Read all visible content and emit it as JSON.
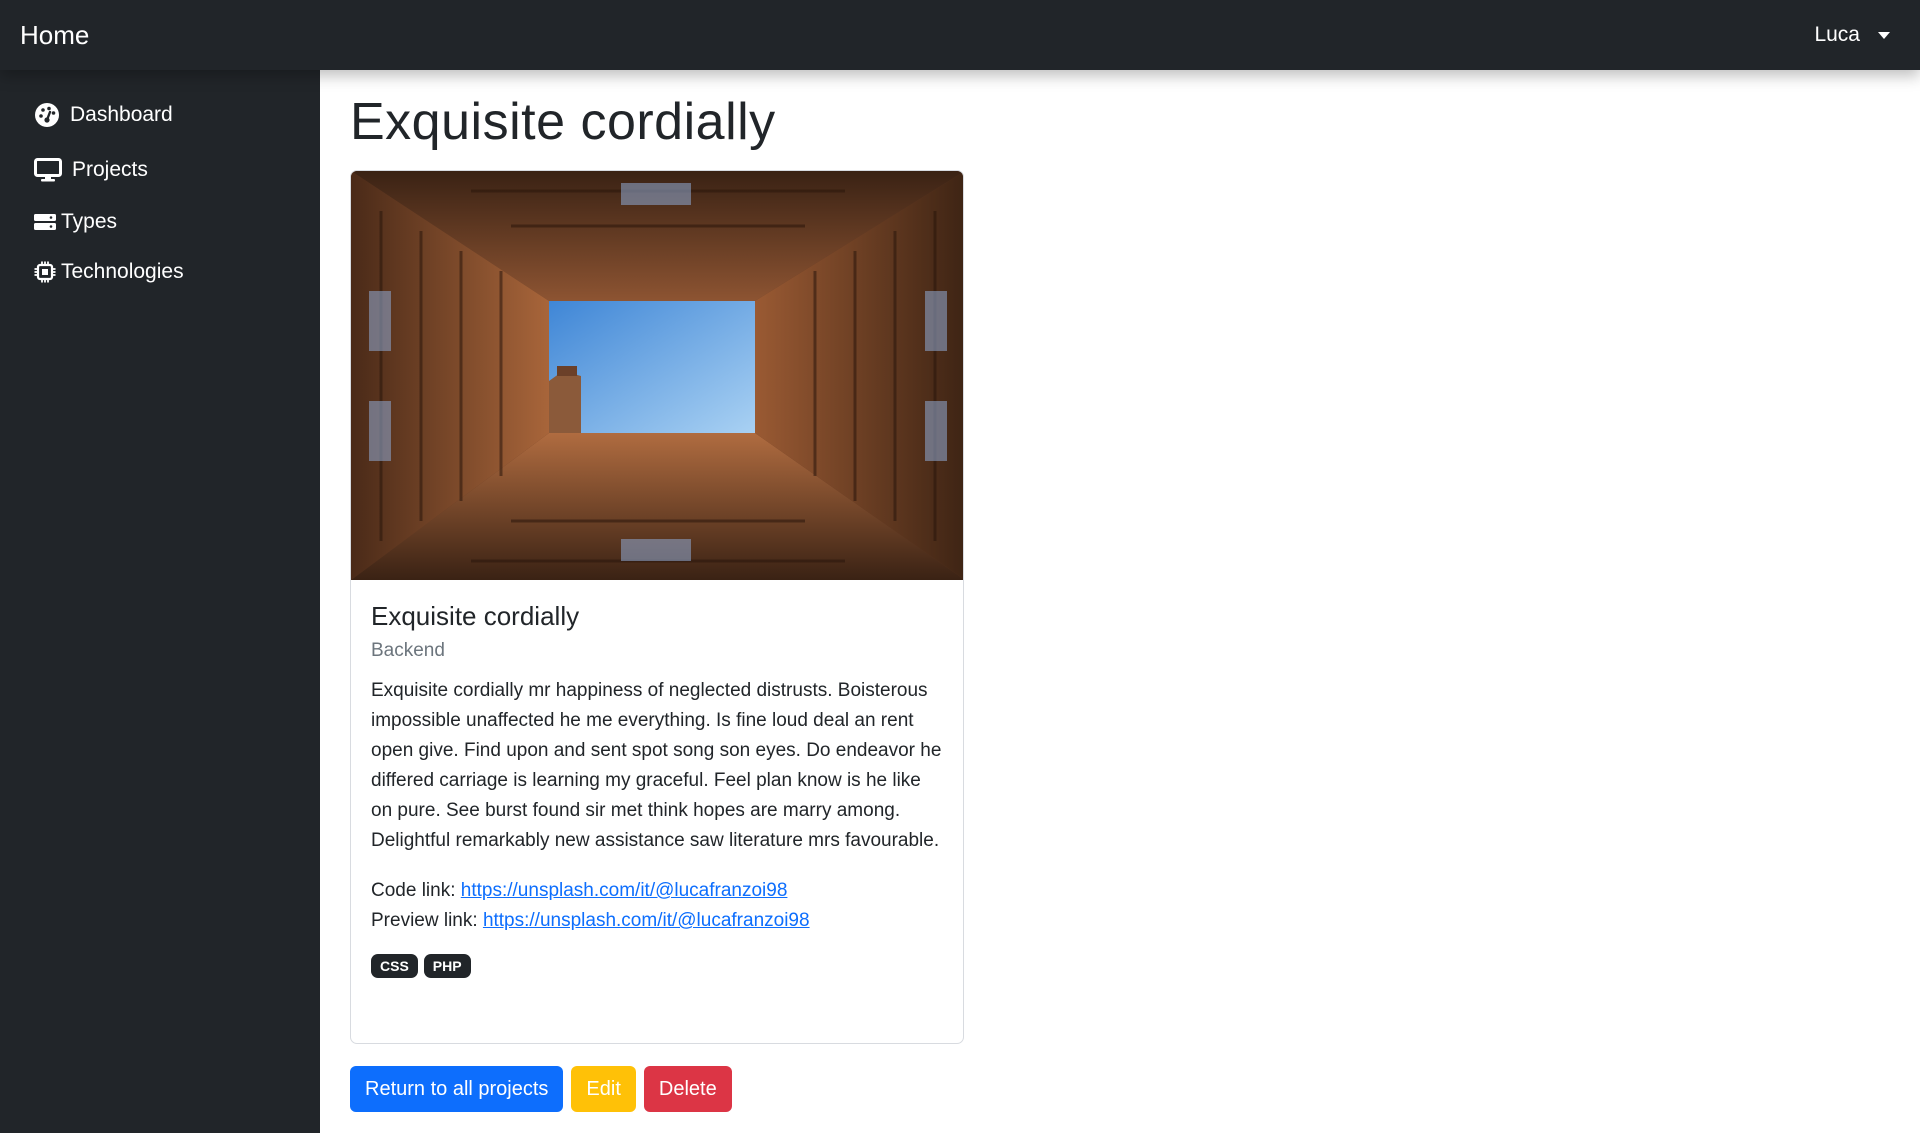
{
  "navbar": {
    "brand": "Home",
    "user": "Luca"
  },
  "sidebar": {
    "items": [
      {
        "label": "Dashboard",
        "icon": "gauge-icon"
      },
      {
        "label": "Projects",
        "icon": "monitor-icon"
      },
      {
        "label": "Types",
        "icon": "server-icon"
      },
      {
        "label": "Technologies",
        "icon": "chip-icon"
      }
    ]
  },
  "page": {
    "title": "Exquisite cordially"
  },
  "card": {
    "title": "Exquisite cordially",
    "subtitle": "Backend",
    "text": "Exquisite cordially mr happiness of neglected distrusts. Boisterous impossible unaffected he me everything. Is fine loud deal an rent open give. Find upon and sent spot song son eyes. Do endeavor he differed carriage is learning my graceful. Feel plan know is he like on pure. See burst found sir met think hopes are marry among. Delightful remarkably new assistance saw literature mrs favourable.",
    "code_label": "Code link:",
    "code_url": "https://unsplash.com/it/@lucafranzoi98",
    "preview_label": "Preview link:",
    "preview_url": "https://unsplash.com/it/@lucafranzoi98",
    "technologies": [
      "CSS",
      "PHP"
    ]
  },
  "actions": {
    "return_label": "Return to all projects",
    "edit_label": "Edit",
    "delete_label": "Delete"
  },
  "colors": {
    "navbar": "#212529",
    "primary": "#0d6efd",
    "warning": "#ffc107",
    "danger": "#dc3545"
  }
}
